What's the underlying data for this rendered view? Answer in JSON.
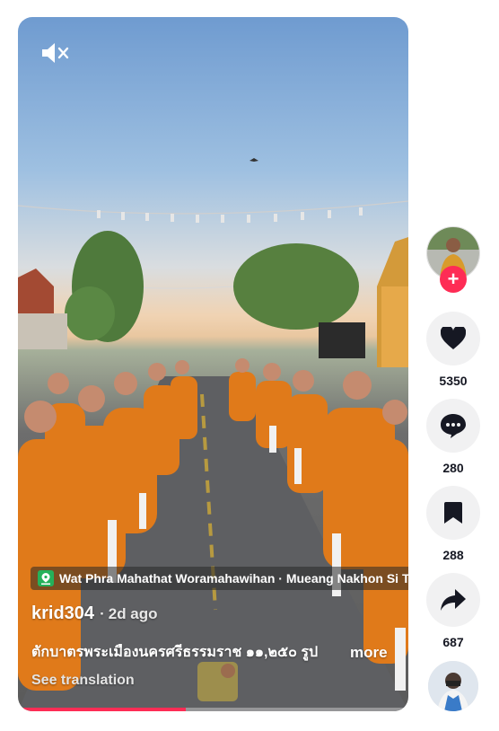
{
  "video": {
    "muted": true,
    "progress_fraction": 0.43,
    "location": "Wat Phra Mahathat Woramahawihan · Mueang Nakhon Si Thammarat",
    "author": "krid304",
    "separator": "·",
    "posted": "2d ago",
    "caption": "ตักบาตรพระเมืองนครศรีธรรมราช ๑๑,๒๕๐ รูป",
    "more_label": "more",
    "translation_label": "See translation",
    "icons": {
      "mute": "speaker-muted-icon",
      "location": "location-pin-icon"
    },
    "colors": {
      "progress": "#fe2c55",
      "location_pin": "#25b15a"
    }
  },
  "actions": {
    "follow_label": "+",
    "like_count": "5350",
    "comment_count": "280",
    "save_count": "288",
    "share_count": "687",
    "icons": [
      "heart-icon",
      "comment-icon",
      "bookmark-icon",
      "share-icon"
    ]
  }
}
